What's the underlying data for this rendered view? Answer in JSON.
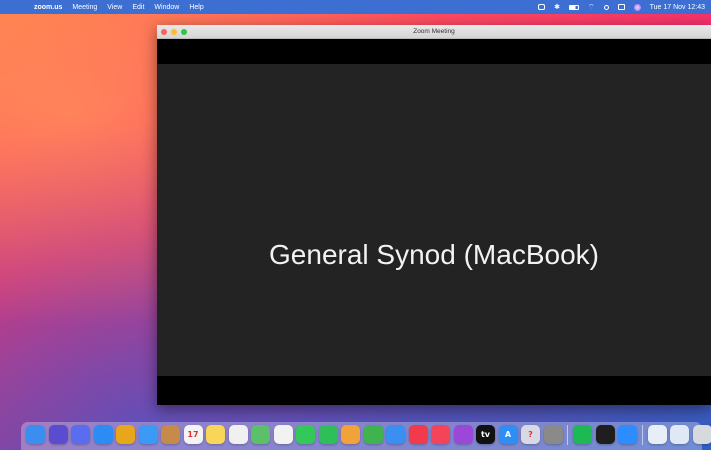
{
  "menubar": {
    "apple_glyph": "",
    "items": [
      "zoom.us",
      "Meeting",
      "View",
      "Edit",
      "Window",
      "Help"
    ],
    "clock": "Tue 17 Nov  12:43"
  },
  "window": {
    "title": "Zoom Meeting",
    "participant_name": "General Synod (MacBook)"
  },
  "dock": {
    "apps": [
      {
        "name": "finder-icon",
        "bg": "#3b8ef0",
        "glyph": ""
      },
      {
        "name": "siri-icon",
        "bg": "#5b4bd1",
        "glyph": ""
      },
      {
        "name": "launchpad-icon",
        "bg": "#5a6cf0",
        "glyph": ""
      },
      {
        "name": "safari-icon",
        "bg": "#2c8cf4",
        "glyph": ""
      },
      {
        "name": "chrome-icon",
        "bg": "#e8a61c",
        "glyph": ""
      },
      {
        "name": "mail-icon",
        "bg": "#3a9af5",
        "glyph": ""
      },
      {
        "name": "contacts-icon",
        "bg": "#c68a4a",
        "glyph": ""
      },
      {
        "name": "calendar-icon",
        "bg": "#f4f4f4",
        "glyph": "17"
      },
      {
        "name": "notes-icon",
        "bg": "#f7d65a",
        "glyph": ""
      },
      {
        "name": "reminders-icon",
        "bg": "#f0f0f0",
        "glyph": ""
      },
      {
        "name": "maps-icon",
        "bg": "#5cc06a",
        "glyph": ""
      },
      {
        "name": "photos-icon",
        "bg": "#f2f2f2",
        "glyph": ""
      },
      {
        "name": "messages-icon",
        "bg": "#34c759",
        "glyph": ""
      },
      {
        "name": "facetime-icon",
        "bg": "#2fbf5a",
        "glyph": ""
      },
      {
        "name": "pages-icon",
        "bg": "#f1a33a",
        "glyph": ""
      },
      {
        "name": "numbers-icon",
        "bg": "#3fb34f",
        "glyph": ""
      },
      {
        "name": "keynote-icon",
        "bg": "#3a8ff0",
        "glyph": ""
      },
      {
        "name": "news-icon",
        "bg": "#f23a4a",
        "glyph": ""
      },
      {
        "name": "music-icon",
        "bg": "#f5445a",
        "glyph": ""
      },
      {
        "name": "podcasts-icon",
        "bg": "#9b48d8",
        "glyph": ""
      },
      {
        "name": "appletv-icon",
        "bg": "#111111",
        "glyph": "tv"
      },
      {
        "name": "appstore-icon",
        "bg": "#2d8ef5",
        "glyph": "A"
      },
      {
        "name": "help-icon",
        "bg": "#d9d9e6",
        "glyph": "?"
      },
      {
        "name": "system-preferences-icon",
        "bg": "#8a8a8a",
        "glyph": ""
      },
      {
        "name": "spotify-icon",
        "bg": "#1db954",
        "glyph": ""
      },
      {
        "name": "terminal-icon",
        "bg": "#1e1e1e",
        "glyph": ""
      },
      {
        "name": "zoom-icon",
        "bg": "#2d8cff",
        "glyph": ""
      },
      {
        "name": "downloads-icon",
        "bg": "#e8eef8",
        "glyph": ""
      },
      {
        "name": "documents-icon",
        "bg": "#dfe8f5",
        "glyph": ""
      },
      {
        "name": "trash-icon",
        "bg": "#d6d9de",
        "glyph": ""
      }
    ]
  }
}
